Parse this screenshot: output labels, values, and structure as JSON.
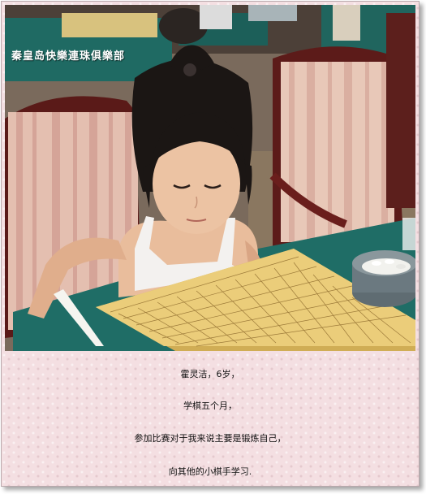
{
  "photo": {
    "watermark": "秦皇岛快樂連珠俱樂部",
    "subject": "girl-studying-go-board"
  },
  "caption": {
    "lines": [
      "霍灵洁，6岁，",
      "学棋五个月，",
      "参加比赛对于我来说主要是锻炼自己，",
      "向其他的小棋手学习."
    ]
  },
  "colors": {
    "background": "#f4dfe2",
    "table": "#1f6d66",
    "board": "#e6c977"
  }
}
